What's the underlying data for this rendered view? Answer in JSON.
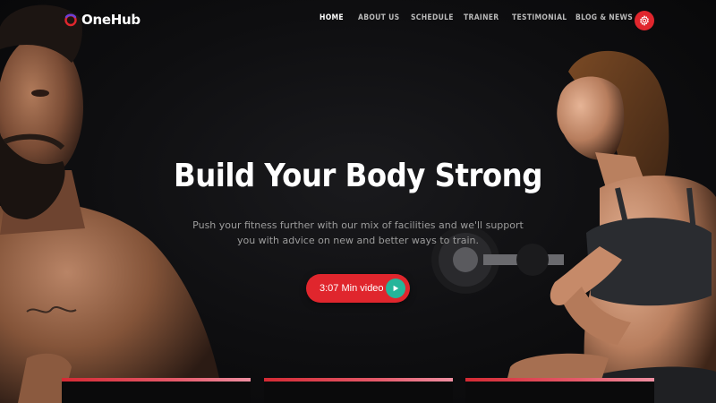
{
  "brand": {
    "name": "OneHub"
  },
  "nav": {
    "items": [
      {
        "label": "HOME",
        "active": true
      },
      {
        "label": "ABOUT US",
        "active": false
      },
      {
        "label": "SCHEDULE",
        "active": false
      },
      {
        "label": "TRAINER",
        "active": false
      },
      {
        "label": "TESTIMONIAL",
        "active": false
      },
      {
        "label": "BLOG & NEWS",
        "active": false
      }
    ],
    "settings_icon": "gear-icon"
  },
  "hero": {
    "title": "Build Your Body Strong",
    "subtitle_line1": "Push your fitness further with our mix of facilities and we'll support",
    "subtitle_line2": "you with advice on new and better ways to train.",
    "video_button": "3:07 Min video",
    "video_icon": "play-icon"
  },
  "colors": {
    "accent": "#e0262d",
    "play": "#25b59a",
    "background": "#0b0b0c"
  }
}
